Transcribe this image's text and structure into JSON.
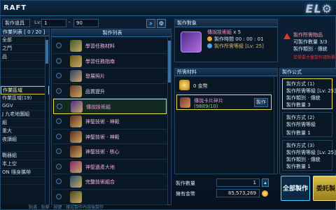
{
  "window": {
    "title": "RAFT"
  },
  "colors": {
    "accent": "#e8e04a",
    "panel": "#0a1826",
    "header": "#1a3a5a"
  },
  "filter": {
    "category": "製作道具",
    "lv_label": "Lv:",
    "lv_min": "1",
    "lv_sep": "-",
    "lv_max": "90"
  },
  "categories": {
    "header": "作業列表 [ 0 / 20 ]",
    "items": [
      "全部",
      "之門",
      "品",
      "",
      "",
      "",
      "作業區域",
      "作業區域(19)",
      "GGV",
      "J 九老地圖組",
      "組",
      "重大",
      "夜讀組",
      "",
      "戰器組",
      "本上空",
      "ON 隨身攜帶",
      ""
    ]
  },
  "items": {
    "header": "製作列表",
    "list": [
      {
        "name": "學習任務材料",
        "color": "#f0b8e6"
      },
      {
        "name": "學習任務指南",
        "color": "#f0b8e6"
      },
      {
        "name": "發展照片",
        "color": "#f0b8e6"
      },
      {
        "name": "品質提升",
        "color": "#cfe3f5"
      },
      {
        "name": "傳說技術組",
        "color": "#f09ad8"
      },
      {
        "name": "神聖技術 · 神殿",
        "color": "#f0b8e6"
      },
      {
        "name": "神聖技術 · 神殿",
        "color": "#f0b8e6"
      },
      {
        "name": "神聖技術 · 核心",
        "color": "#f0b8e6"
      },
      {
        "name": "神聖遺產大地",
        "color": "#f09ad8"
      },
      {
        "name": "完整技術組合",
        "color": "#f0b8e6"
      },
      {
        "name": "",
        "color": "#f0b8e6"
      }
    ]
  },
  "target": {
    "header": "製作對象",
    "name": "傳說技術組",
    "count": "x 5",
    "time_label": "製作時間",
    "time": "00 : 00 : 01",
    "level_text": "製作所需等級 [Lv: 25]"
  },
  "note": {
    "line1": "製作所需物品",
    "line2": "可製作數量 3/3",
    "line3": "製作類別 · 傳統",
    "line4": "若需要大量製作請點擊"
  },
  "materials": {
    "header": "所需材料",
    "rows": [
      {
        "name": "0 金幣",
        "qty": "",
        "has_button": false
      },
      {
        "name": "傳說卡片碎片",
        "qty": "(9889/10)",
        "has_button": true,
        "button": "製作"
      }
    ]
  },
  "formula": {
    "header": "製作公式",
    "blocks": [
      {
        "l1": "製作方式 (1)",
        "l2": "製作所需等級 [Lv: 25]",
        "l3": "製作類別 · 傳統",
        "l4": "製作數量 3"
      },
      {
        "l1": "製作方式 (2)",
        "l2": "製作所需等級",
        "l3": "製作數量 1"
      },
      {
        "l1": "製作方式 (3)",
        "l2": "製作所需等級 [Lv: 25]",
        "l3": "製作類別 · 傳統",
        "l4": "製作數量 1"
      }
    ]
  },
  "craft": {
    "qty_label": "製作數量",
    "qty": "1",
    "gold_label": "擁有金幣",
    "gold": "85,573,269",
    "craft_all": "全部製作",
    "commission": "委託製"
  },
  "footer": {
    "hint": "點選 · 點擊 · 按鍵 · 確認製作內容後製作"
  }
}
